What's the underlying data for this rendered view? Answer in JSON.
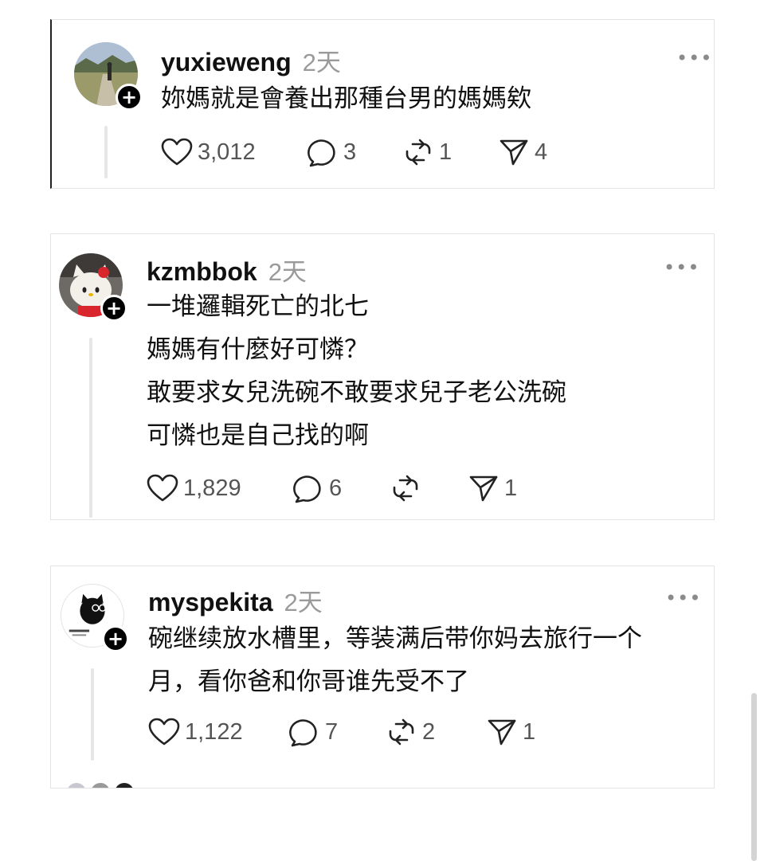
{
  "posts": [
    {
      "username": "yuxieweng",
      "time": "2天",
      "more_label": "•••",
      "avatar_icon": "landscape-photo",
      "lines": [
        "妳媽就是會養出那種台男的媽媽欸"
      ],
      "likes": "3,012",
      "replies": "3",
      "reposts": "1",
      "shares": "4"
    },
    {
      "username": "kzmbbok",
      "time": "2天",
      "more_label": "•••",
      "avatar_icon": "hello-kitty-plush-photo",
      "lines": [
        "一堆邏輯死亡的北七",
        "媽媽有什麼好可憐？",
        "敢要求女兒洗碗不敢要求兒子老公洗碗",
        "可憐也是自己找的啊"
      ],
      "likes": "1,829",
      "replies": "6",
      "reposts": "",
      "shares": "1"
    },
    {
      "username": "myspekita",
      "time": "2天",
      "more_label": "•••",
      "avatar_icon": "black-cat-logo",
      "lines": [
        "碗继续放水槽里，等装满后带你妈去旅行一个",
        "月，看你爸和你哥谁先受不了"
      ],
      "likes": "1,122",
      "replies": "7",
      "reposts": "2",
      "shares": "1"
    }
  ],
  "icons": {
    "plus": "+",
    "like": "heart-icon",
    "reply": "comment-icon",
    "repost": "repost-icon",
    "share": "send-icon"
  },
  "colors": {
    "text": "#111111",
    "muted": "#9a9a9a",
    "count": "#555555",
    "border": "#e3e3e3",
    "thread": "#e6e6e6"
  }
}
